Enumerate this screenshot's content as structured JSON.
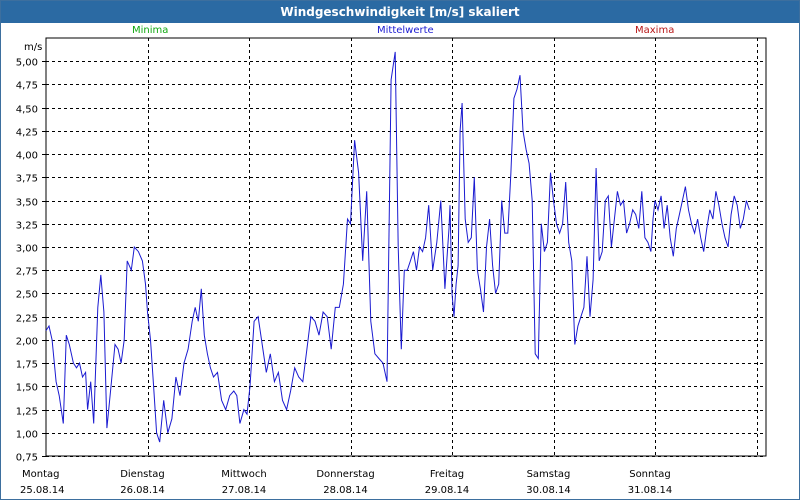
{
  "title": "Windgeschwindigkeit [m/s] skaliert",
  "legend": {
    "min": "Minima",
    "mean": "Mittelwerte",
    "max": "Maxima",
    "min_color": "#11a811",
    "mean_color": "#1b1bd1",
    "max_color": "#b81818"
  },
  "chart_data": {
    "type": "line",
    "title": "Windgeschwindigkeit [m/s] skaliert",
    "ylabel": "m/s",
    "ylim": [
      0.75,
      5.25
    ],
    "yticks": [
      "0,75",
      "1,00",
      "1,25",
      "1,50",
      "1,75",
      "2,00",
      "2,25",
      "2,50",
      "2,75",
      "3,00",
      "3,25",
      "3,50",
      "3,75",
      "4,00",
      "4,25",
      "4,50",
      "4,75",
      "5,00"
    ],
    "ytick_values": [
      0.75,
      1.0,
      1.25,
      1.5,
      1.75,
      2.0,
      2.25,
      2.5,
      2.75,
      3.0,
      3.25,
      3.5,
      3.75,
      4.0,
      4.25,
      4.5,
      4.75,
      5.0
    ],
    "x_days": [
      {
        "day": "Montag",
        "date": "25.08.14"
      },
      {
        "day": "Dienstag",
        "date": "26.08.14"
      },
      {
        "day": "Mittwoch",
        "date": "27.08.14"
      },
      {
        "day": "Donnerstag",
        "date": "28.08.14"
      },
      {
        "day": "Freitag",
        "date": "29.08.14"
      },
      {
        "day": "Samstag",
        "date": "30.08.14"
      },
      {
        "day": "Sonntag",
        "date": "31.08.14"
      }
    ],
    "grid": true,
    "series": [
      {
        "name": "Mittelwerte",
        "color": "#1b1bd1",
        "x_days": [
          0,
          0.03,
          0.06,
          0.1,
          0.13,
          0.17,
          0.2,
          0.23,
          0.27,
          0.3,
          0.33,
          0.36,
          0.39,
          0.41,
          0.44,
          0.47,
          0.51,
          0.54,
          0.57,
          0.6,
          0.64,
          0.68,
          0.71,
          0.74,
          0.77,
          0.8,
          0.84,
          0.87,
          0.91,
          0.95,
          0.98,
          1.0,
          1.03,
          1.06,
          1.09,
          1.12,
          1.16,
          1.2,
          1.24,
          1.28,
          1.32,
          1.36,
          1.4,
          1.44,
          1.47,
          1.5,
          1.53,
          1.56,
          1.59,
          1.62,
          1.65,
          1.69,
          1.73,
          1.77,
          1.81,
          1.85,
          1.88,
          1.91,
          1.95,
          1.98,
          2.01,
          2.05,
          2.09,
          2.13,
          2.17,
          2.21,
          2.25,
          2.29,
          2.33,
          2.37,
          2.41,
          2.45,
          2.49,
          2.53,
          2.57,
          2.61,
          2.65,
          2.69,
          2.73,
          2.77,
          2.81,
          2.85,
          2.89,
          2.93,
          2.97,
          3.0,
          3.04,
          3.08,
          3.12,
          3.16,
          3.2,
          3.24,
          3.28,
          3.32,
          3.36,
          3.4,
          3.44,
          3.47,
          3.5,
          3.53,
          3.56,
          3.59,
          3.62,
          3.65,
          3.68,
          3.71,
          3.74,
          3.77,
          3.81,
          3.85,
          3.89,
          3.93,
          3.97,
          3.98,
          4.0,
          4.02,
          4.04,
          4.06,
          4.08,
          4.1,
          4.13,
          4.16,
          4.19,
          4.22,
          4.25,
          4.28,
          4.31,
          4.34,
          4.37,
          4.4,
          4.43,
          4.46,
          4.49,
          4.52,
          4.55,
          4.58,
          4.61,
          4.64,
          4.67,
          4.7,
          4.73,
          4.76,
          4.79,
          4.82,
          4.85,
          4.88,
          4.91,
          4.94,
          4.97,
          5.0,
          5.03,
          5.06,
          5.09,
          5.12,
          5.15,
          5.18,
          5.21,
          5.24,
          5.27,
          5.3,
          5.33,
          5.36,
          5.39,
          5.42,
          5.45,
          5.48,
          5.51,
          5.54,
          5.57,
          5.6,
          5.63,
          5.66,
          5.69,
          5.72,
          5.75,
          5.78,
          5.81,
          5.84,
          5.87,
          5.9,
          5.93,
          5.96,
          5.98,
          6.0,
          6.03,
          6.06,
          6.09,
          6.12,
          6.15,
          6.18,
          6.21,
          6.24,
          6.27,
          6.3,
          6.33,
          6.36,
          6.39,
          6.42,
          6.45,
          6.48,
          6.51,
          6.54,
          6.57,
          6.6,
          6.63,
          6.66,
          6.69,
          6.72,
          6.75,
          6.78,
          6.81,
          6.84,
          6.87,
          6.9,
          6.93,
          6.96,
          6.99,
          7.01,
          7.04,
          7.07,
          7.1,
          7.13
        ],
        "values": [
          2.1,
          2.15,
          2.0,
          1.55,
          1.4,
          1.1,
          2.05,
          1.95,
          1.75,
          1.7,
          1.75,
          1.6,
          1.65,
          1.25,
          1.55,
          1.1,
          2.35,
          2.7,
          2.3,
          1.05,
          1.5,
          1.95,
          1.9,
          1.75,
          2.0,
          2.85,
          2.75,
          3.0,
          2.95,
          2.85,
          2.6,
          2.3,
          2.0,
          1.5,
          1.0,
          0.9,
          1.35,
          1.0,
          1.15,
          1.6,
          1.4,
          1.75,
          1.9,
          2.2,
          2.35,
          2.2,
          2.55,
          2.05,
          1.85,
          1.7,
          1.6,
          1.65,
          1.35,
          1.25,
          1.4,
          1.45,
          1.4,
          1.1,
          1.25,
          1.2,
          1.5,
          2.2,
          2.25,
          1.95,
          1.65,
          1.85,
          1.55,
          1.65,
          1.35,
          1.25,
          1.45,
          1.7,
          1.6,
          1.55,
          1.9,
          2.25,
          2.2,
          2.05,
          2.3,
          2.25,
          1.9,
          2.35,
          2.35,
          2.6,
          3.3,
          3.25,
          4.15,
          3.8,
          2.85,
          3.6,
          2.2,
          1.85,
          1.8,
          1.75,
          1.55,
          4.8,
          5.1,
          3.0,
          1.9,
          2.75,
          2.75,
          2.85,
          2.95,
          2.75,
          3.0,
          2.95,
          3.1,
          3.45,
          2.75,
          3.05,
          3.5,
          2.55,
          3.2,
          3.45,
          2.5,
          2.25,
          2.6,
          2.8,
          4.25,
          4.55,
          3.3,
          3.05,
          3.1,
          3.75,
          2.75,
          2.55,
          2.3,
          3.0,
          3.3,
          2.8,
          2.5,
          2.6,
          3.5,
          3.15,
          3.15,
          3.8,
          4.6,
          4.7,
          4.85,
          4.25,
          4.05,
          3.9,
          3.5,
          1.85,
          1.8,
          3.25,
          2.95,
          3.05,
          3.8,
          3.5,
          3.25,
          3.15,
          3.25,
          3.7,
          3.05,
          2.85,
          1.95,
          2.15,
          2.25,
          2.35,
          2.9,
          2.25,
          2.65,
          3.85,
          2.85,
          2.95,
          3.5,
          3.55,
          3.0,
          3.3,
          3.6,
          3.45,
          3.5,
          3.15,
          3.25,
          3.4,
          3.35,
          3.2,
          3.6,
          3.1,
          3.05,
          2.95,
          3.3,
          3.5,
          3.4,
          3.55,
          3.2,
          3.45,
          3.1,
          2.9,
          3.2,
          3.35,
          3.5,
          3.65,
          3.4,
          3.25,
          3.15,
          3.3,
          3.1,
          2.95,
          3.2,
          3.4,
          3.3,
          3.6,
          3.45,
          3.25,
          3.1,
          3.0,
          3.35,
          3.55,
          3.45,
          3.2,
          3.3,
          3.5,
          3.4
        ]
      }
    ]
  }
}
